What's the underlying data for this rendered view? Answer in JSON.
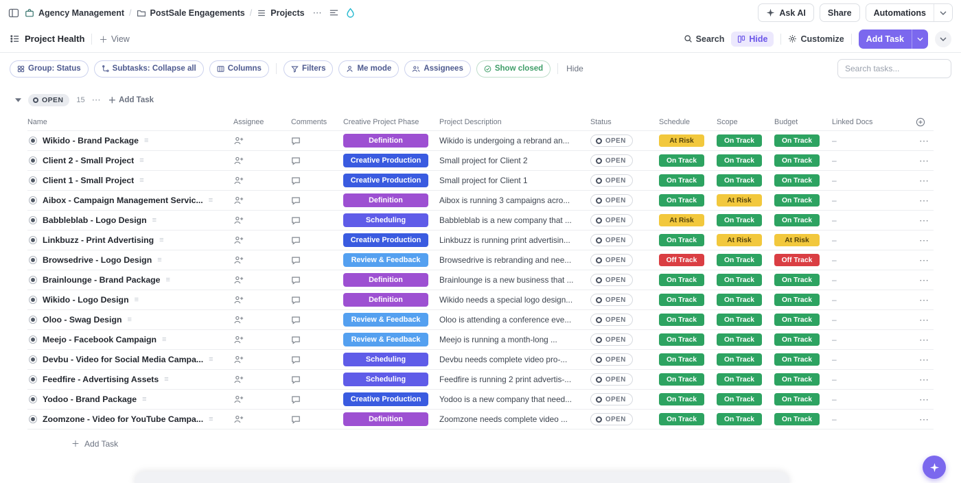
{
  "topbar": {
    "breadcrumb": [
      {
        "label": "Agency Management"
      },
      {
        "label": "PostSale Engagements"
      },
      {
        "label": "Projects"
      }
    ],
    "ellipsis": "⋯",
    "ask_ai_label": "Ask AI",
    "share_label": "Share",
    "automations_label": "Automations"
  },
  "viewbar": {
    "view_name": "Project Health",
    "add_view_label": "View",
    "search_label": "Search",
    "hide_label": "Hide",
    "customize_label": "Customize",
    "add_task_label": "Add Task"
  },
  "toolbar": {
    "group_label": "Group: Status",
    "subtasks_label": "Subtasks: Collapse all",
    "columns_label": "Columns",
    "filters_label": "Filters",
    "me_mode_label": "Me mode",
    "assignees_label": "Assignees",
    "show_closed_label": "Show closed",
    "hide_label": "Hide",
    "search_placeholder": "Search tasks..."
  },
  "group_header": {
    "status": "OPEN",
    "count": "15",
    "ellipsis": "⋯",
    "add_task_label": "Add Task"
  },
  "table": {
    "columns": [
      "Name",
      "Assignee",
      "Comments",
      "Creative Project Phase",
      "Project Description",
      "Status",
      "Schedule",
      "Scope",
      "Budget",
      "Linked Docs"
    ],
    "rows": [
      {
        "name": "Wikido - Brand Package",
        "phase": "Definition",
        "description": "Wikido is undergoing a rebrand an...",
        "status": "OPEN",
        "schedule": "At Risk",
        "scope": "On Track",
        "budget": "On Track",
        "linked": "–"
      },
      {
        "name": "Client 2 - Small Project",
        "phase": "Creative Production",
        "description": "Small project for Client 2",
        "status": "OPEN",
        "schedule": "On Track",
        "scope": "On Track",
        "budget": "On Track",
        "linked": "–"
      },
      {
        "name": "Client 1 - Small Project",
        "phase": "Creative Production",
        "description": "Small project for Client 1",
        "status": "OPEN",
        "schedule": "On Track",
        "scope": "On Track",
        "budget": "On Track",
        "linked": "–"
      },
      {
        "name": "Aibox - Campaign Management Servic...",
        "phase": "Definition",
        "description": "Aibox is running 3 campaigns acro...",
        "status": "OPEN",
        "schedule": "On Track",
        "scope": "At Risk",
        "budget": "On Track",
        "linked": "–"
      },
      {
        "name": "Babbleblab - Logo Design",
        "phase": "Scheduling",
        "description": "Babbleblab is a new company that ...",
        "status": "OPEN",
        "schedule": "At Risk",
        "scope": "On Track",
        "budget": "On Track",
        "linked": "–"
      },
      {
        "name": "Linkbuzz - Print Advertising",
        "phase": "Creative Production",
        "description": "Linkbuzz is running print advertisin...",
        "status": "OPEN",
        "schedule": "On Track",
        "scope": "At Risk",
        "budget": "At Risk",
        "linked": "–"
      },
      {
        "name": "Browsedrive - Logo Design",
        "phase": "Review & Feedback",
        "description": "Browsedrive is rebranding and nee...",
        "status": "OPEN",
        "schedule": "Off Track",
        "scope": "On Track",
        "budget": "Off Track",
        "linked": "–"
      },
      {
        "name": "Brainlounge - Brand Package",
        "phase": "Definition",
        "description": "Brainlounge is a new business that ...",
        "status": "OPEN",
        "schedule": "On Track",
        "scope": "On Track",
        "budget": "On Track",
        "linked": "–"
      },
      {
        "name": "Wikido - Logo Design",
        "phase": "Definition",
        "description": "Wikido needs a special logo design...",
        "status": "OPEN",
        "schedule": "On Track",
        "scope": "On Track",
        "budget": "On Track",
        "linked": "–"
      },
      {
        "name": "Oloo - Swag Design",
        "phase": "Review & Feedback",
        "description": "Oloo is attending a conference eve...",
        "status": "OPEN",
        "schedule": "On Track",
        "scope": "On Track",
        "budget": "On Track",
        "linked": "–"
      },
      {
        "name": "Meejo - Facebook Campaign",
        "phase": "Review & Feedback",
        "description": "Meejo is running a month-long ...",
        "status": "OPEN",
        "schedule": "On Track",
        "scope": "On Track",
        "budget": "On Track",
        "linked": "–"
      },
      {
        "name": "Devbu - Video for Social Media Campa...",
        "phase": "Scheduling",
        "description": "Devbu needs complete video pro-...",
        "status": "OPEN",
        "schedule": "On Track",
        "scope": "On Track",
        "budget": "On Track",
        "linked": "–"
      },
      {
        "name": "Feedfire - Advertising Assets",
        "phase": "Scheduling",
        "description": "Feedfire is running 2 print advertis-...",
        "status": "OPEN",
        "schedule": "On Track",
        "scope": "On Track",
        "budget": "On Track",
        "linked": "–"
      },
      {
        "name": "Yodoo - Brand Package",
        "phase": "Creative Production",
        "description": "Yodoo is a new company that need...",
        "status": "OPEN",
        "schedule": "On Track",
        "scope": "On Track",
        "budget": "On Track",
        "linked": "–"
      },
      {
        "name": "Zoomzone - Video for YouTube Campa...",
        "phase": "Definition",
        "description": "Zoomzone needs complete video ...",
        "status": "OPEN",
        "schedule": "On Track",
        "scope": "On Track",
        "budget": "On Track",
        "linked": "–"
      }
    ]
  },
  "footer": {
    "add_task_label": "Add Task"
  },
  "colors": {
    "accent": "#7b68ee",
    "phase": {
      "Definition": "#9d50d2",
      "Creative Production": "#3a5be0",
      "Scheduling": "#5f5ce8",
      "Review & Feedback": "#54a0f0"
    },
    "health": {
      "On Track": {
        "bg": "#2da361",
        "fg": "#ffffff"
      },
      "At Risk": {
        "bg": "#f2c83d",
        "fg": "#54430b"
      },
      "Off Track": {
        "bg": "#da3e43",
        "fg": "#ffffff"
      }
    }
  }
}
